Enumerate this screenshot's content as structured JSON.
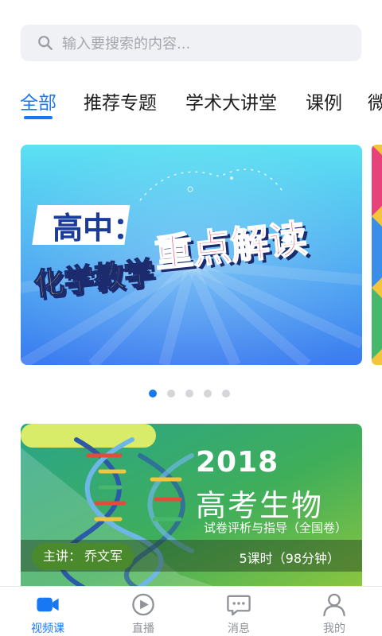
{
  "search": {
    "placeholder": "输入要搜索的内容..."
  },
  "tabs": [
    {
      "label": "全部",
      "active": true
    },
    {
      "label": "推荐专题"
    },
    {
      "label": "学术大讲堂"
    },
    {
      "label": "课例"
    },
    {
      "label": "微"
    }
  ],
  "banner": {
    "line1": "高中：",
    "line2a": "化学教学",
    "line2b": "重点解读",
    "pages": 5,
    "current_page": 1
  },
  "course": {
    "year": "2018",
    "title": "高考生物",
    "subtitle": "试卷评析与指导（全国卷）",
    "lecturer_prefix": "主讲：",
    "lecturer": "乔文军",
    "lessons": "5课时（98分钟）"
  },
  "nav": [
    {
      "label": "视频课",
      "icon": "video-camera-icon",
      "active": true
    },
    {
      "label": "直播",
      "icon": "play-circle-icon"
    },
    {
      "label": "消息",
      "icon": "chat-bubble-icon"
    },
    {
      "label": "我的",
      "icon": "user-icon"
    }
  ],
  "colors": {
    "accent": "#1877f2",
    "search_bg": "#f0f1f4",
    "nav_inactive": "#8f9297"
  }
}
